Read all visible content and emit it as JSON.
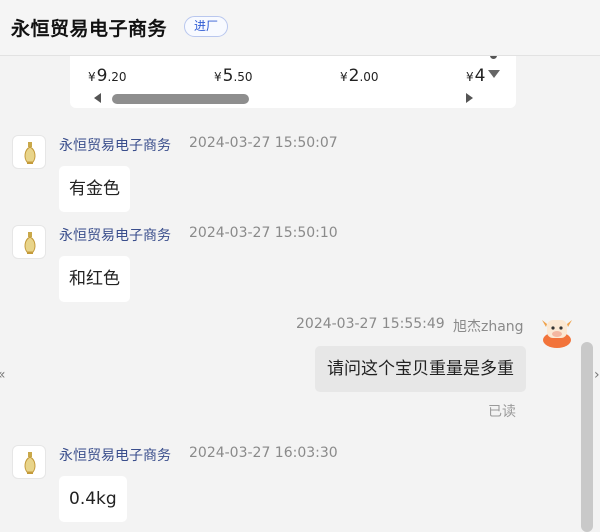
{
  "header": {
    "shop_name": "永恒贸易电子商务",
    "shop_tag": "进厂"
  },
  "product_card": {
    "prices": [
      {
        "currency": "¥",
        "int": "9",
        "dec": ".20"
      },
      {
        "currency": "¥",
        "int": "5",
        "dec": ".50"
      },
      {
        "currency": "¥",
        "int": "2",
        "dec": ".00"
      },
      {
        "currency": "¥",
        "int": "4",
        "dec": ""
      }
    ]
  },
  "messages": [
    {
      "sender": "永恒贸易电子商务",
      "time": "2024-03-27 15:50:07",
      "text": "有金色",
      "side": "left"
    },
    {
      "sender": "永恒贸易电子商务",
      "time": "2024-03-27 15:50:10",
      "text": "和红色",
      "side": "left"
    },
    {
      "sender": "旭杰zhang",
      "time": "2024-03-27 15:55:49",
      "text": "请问这个宝贝重量是多重",
      "side": "right",
      "status": "已读"
    },
    {
      "sender": "永恒贸易电子商务",
      "time": "2024-03-27 16:03:30",
      "text": "0.4kg",
      "side": "left"
    }
  ],
  "icons": {
    "shop_avatar": "perfume-bottle-icon",
    "user_avatar": "cartoon-cow-icon"
  },
  "colors": {
    "accent_blue": "#2f5bd3",
    "name_blue": "#3a4e8c",
    "bubble_mine": "#e7e7e7",
    "bubble_other": "#ffffff"
  }
}
